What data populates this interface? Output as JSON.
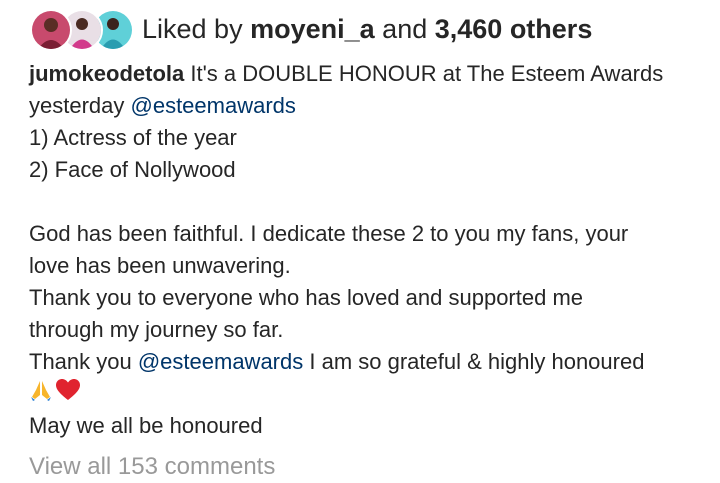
{
  "likes": {
    "prefix": "Liked by",
    "first_user": "moyeni_a",
    "joiner": "and",
    "others": "3,460 others"
  },
  "post": {
    "username": "jumokeodetola",
    "caption_lines": [
      {
        "text": " It's a DOUBLE HONOUR at The Esteem Awards yesterday "
      },
      {
        "mention": "@esteemawards"
      },
      {
        "text": "1) Actress of the year"
      },
      {
        "text": "2) Face of Nollywood"
      },
      {
        "text": "God has been faithful. I dedicate these 2 to you my fans, your love has been unwavering."
      },
      {
        "text": "Thank you to everyone who has loved and supported me through my journey so far."
      },
      {
        "text_prefix": "Thank you ",
        "mention": "@esteemawards",
        "text_suffix": " I am so grateful & highly honoured"
      },
      {
        "text": "May we all be honoured"
      }
    ]
  },
  "line1": " It's a DOUBLE HONOUR at The Esteem Awards",
  "line2": "yesterday ",
  "mention1": "@esteemawards",
  "line3": "1) Actress of the year",
  "line4": "2) Face of Nollywood",
  "line5": "God has been faithful. I dedicate these 2 to you my fans, your",
  "line6": "love has been unwavering.",
  "line7": "Thank you to everyone who has loved and supported me",
  "line8": "through my journey so far.",
  "line9_prefix": "Thank you ",
  "mention2": "@esteemawards",
  "line9_suffix": " I am so grateful & highly honoured",
  "emojis": [
    "praying-hands-emoji",
    "red-heart-emoji"
  ],
  "line11": "May we all be honoured",
  "comments_link": "View all 153 comments",
  "colors": {
    "text": "#262626",
    "mention": "#003569",
    "muted": "#999999",
    "heart": "#e0242f",
    "hands": "#f7b52c"
  }
}
